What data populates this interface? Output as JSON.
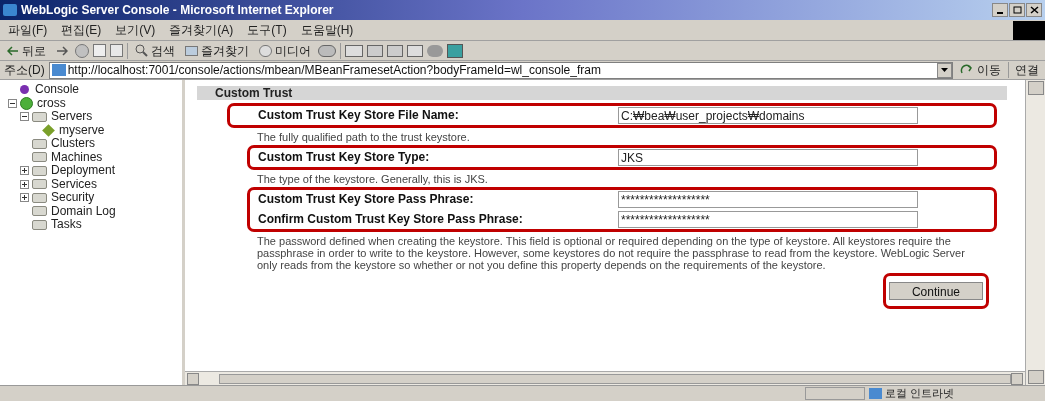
{
  "window": {
    "title": "WebLogic Server Console - Microsoft Internet Explorer"
  },
  "menu": [
    "파일(F)",
    "편집(E)",
    "보기(V)",
    "즐겨찾기(A)",
    "도구(T)",
    "도움말(H)"
  ],
  "toolbar": {
    "back": "뒤로",
    "search": "검색",
    "favorites": "즐겨찾기",
    "media": "미디어"
  },
  "address": {
    "label": "주소(D)",
    "url": "http://localhost:7001/console/actions/mbean/MBeanFramesetAction?bodyFrameId=wl_console_fram",
    "go": "이동",
    "links": "연결"
  },
  "tree": [
    {
      "label": "Console",
      "kind": "console"
    },
    {
      "label": "cross",
      "kind": "domain",
      "expanded": true,
      "children": [
        {
          "label": "Servers",
          "kind": "folder",
          "expanded": true,
          "children": [
            {
              "label": "myserve",
              "kind": "server"
            }
          ]
        },
        {
          "label": "Clusters",
          "kind": "folder"
        },
        {
          "label": "Machines",
          "kind": "folder"
        },
        {
          "label": "Deployment",
          "kind": "folder",
          "expanded": false
        },
        {
          "label": "Services",
          "kind": "folder",
          "expanded": false
        },
        {
          "label": "Security",
          "kind": "folder",
          "expanded": false
        },
        {
          "label": "Domain Log",
          "kind": "folder"
        },
        {
          "label": "Tasks",
          "kind": "folder"
        }
      ]
    }
  ],
  "section": {
    "title": "Custom Trust",
    "groups": [
      {
        "fields": [
          {
            "label": "Custom Trust Key Store File Name:",
            "value": "C:₩bea₩user_projects₩domains"
          }
        ],
        "help": "The fully qualified path to the trust keystore."
      },
      {
        "fields": [
          {
            "label": "Custom Trust Key Store Type:",
            "value": "JKS"
          }
        ],
        "help": "The type of the keystore. Generally, this is JKS."
      },
      {
        "fields": [
          {
            "label": "Custom Trust Key Store Pass Phrase:",
            "value": "*******************"
          },
          {
            "label": "Confirm Custom Trust Key Store Pass Phrase:",
            "value": "*******************"
          }
        ],
        "help": "The password defined when creating the keystore. This field is optional or required depending on the type of keystore. All keystores require the passphrase in order to write to the keystore. However, some keystores do not require the passphrase to read from the keystore. WebLogic Server only reads from the keystore so whether or not you define this property depends on the requirements of the keystore."
      }
    ],
    "button": "Continue"
  },
  "status_bar": {
    "zone": "로컬 인트라넷"
  }
}
